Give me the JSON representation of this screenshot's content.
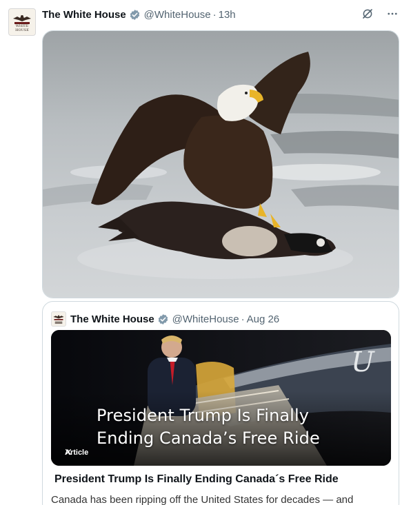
{
  "post": {
    "author_name": "The White House",
    "handle": "@WhiteHouse",
    "separator": "·",
    "time": "13h",
    "avatar_icon": "white-house-logo",
    "verified_icon": "verified-badge-icon",
    "accent": "#1d9bf0",
    "media_alt_icon": "eagle-goose-photo"
  },
  "quote": {
    "author_name": "The White House",
    "handle": "@WhiteHouse",
    "separator": "·",
    "date": "Aug 26",
    "card_headline_line1": "President Trump Is Finally",
    "card_headline_line2": "Ending Canada’s Free Ride",
    "card_tag": "Article",
    "article_title": "President Trump Is Finally Ending Canada´s Free Ride",
    "article_description": "Canada has been ripping off the United States for decades — and"
  }
}
